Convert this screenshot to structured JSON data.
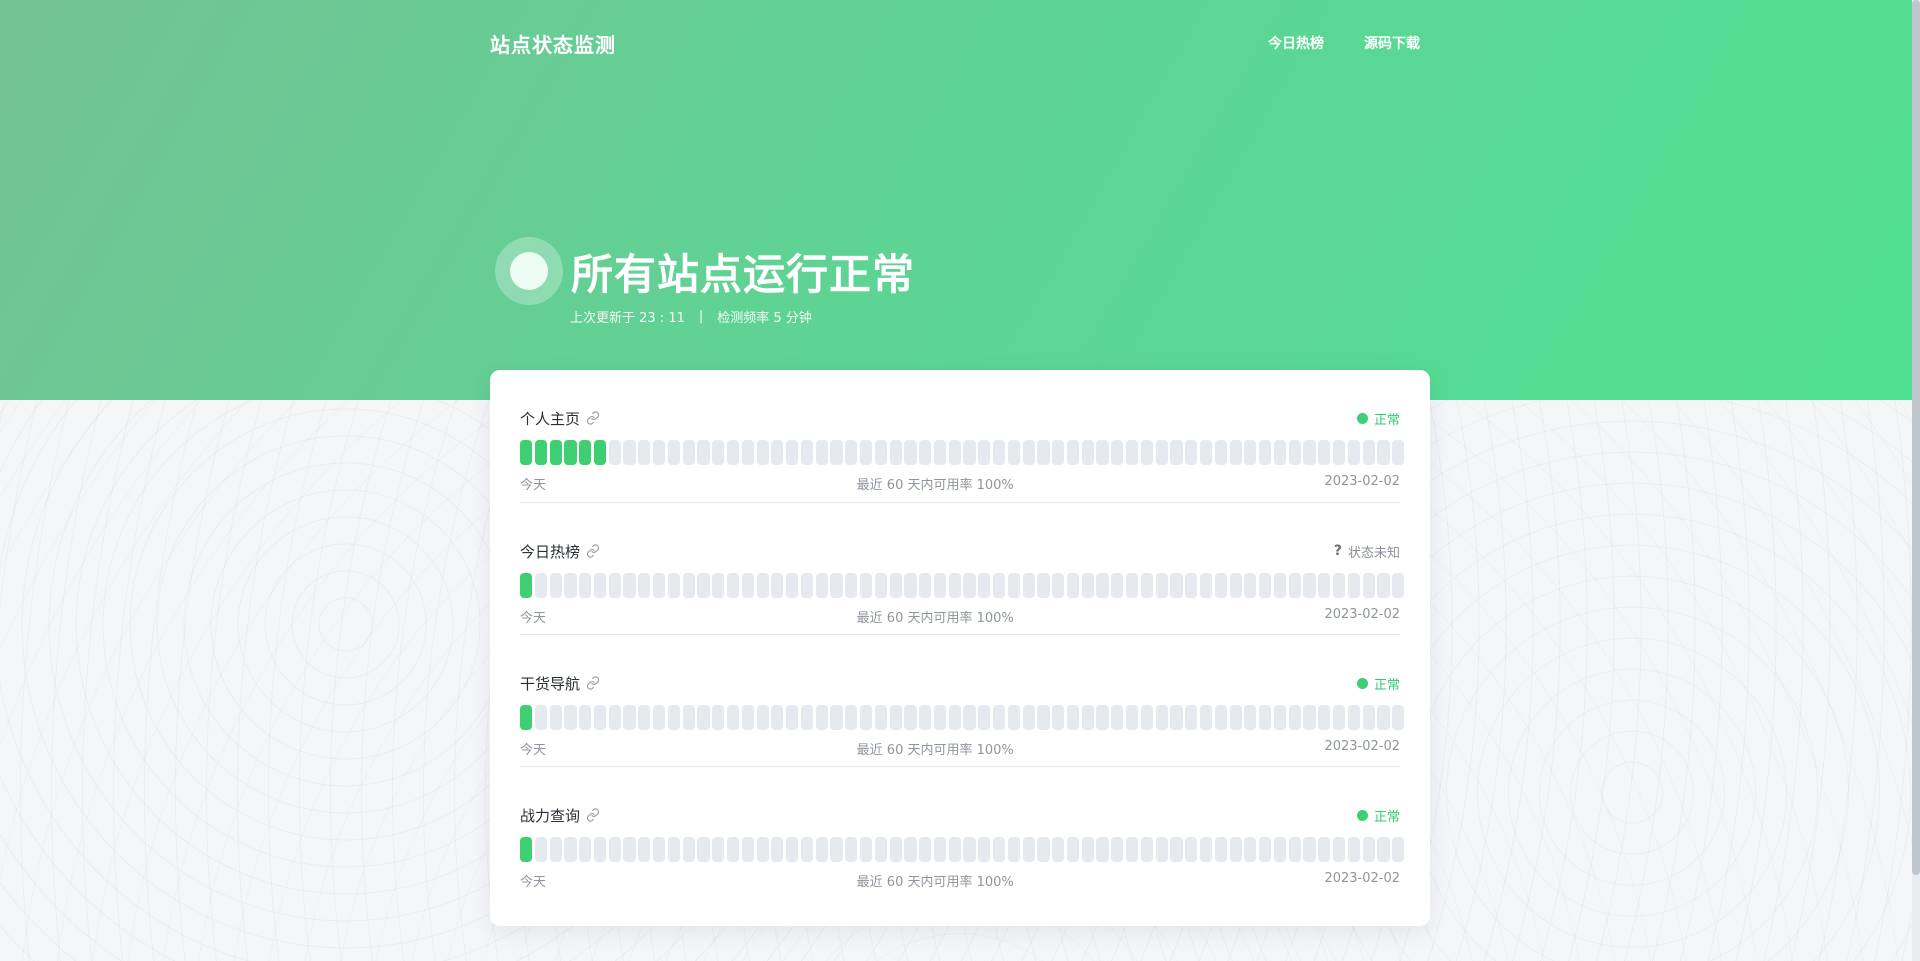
{
  "header": {
    "brand": "站点状态监测",
    "nav": [
      {
        "label": "今日热榜"
      },
      {
        "label": "源码下载"
      }
    ]
  },
  "hero": {
    "title": "所有站点运行正常",
    "updated": "上次更新于 23 : 11",
    "separator": "|",
    "frequency": "检测频率 5 分钟"
  },
  "colors": {
    "accent": "#3ecf73",
    "bar_empty": "#e6e9ed"
  },
  "monitors": [
    {
      "name": "个人主页",
      "status": "正常",
      "status_type": "ok",
      "bars_total": 60,
      "bars_up": 6,
      "footer_left": "今天",
      "footer_mid": "最近 60 天内可用率 100%",
      "footer_right": "2023-02-02"
    },
    {
      "name": "今日热榜",
      "status": "状态未知",
      "status_type": "unknown",
      "bars_total": 60,
      "bars_up": 1,
      "footer_left": "今天",
      "footer_mid": "最近 60 天内可用率 100%",
      "footer_right": "2023-02-02"
    },
    {
      "name": "干货导航",
      "status": "正常",
      "status_type": "ok",
      "bars_total": 60,
      "bars_up": 1,
      "footer_left": "今天",
      "footer_mid": "最近 60 天内可用率 100%",
      "footer_right": "2023-02-02"
    },
    {
      "name": "战力查询",
      "status": "正常",
      "status_type": "ok",
      "bars_total": 60,
      "bars_up": 1,
      "footer_left": "今天",
      "footer_mid": "最近 60 天内可用率 100%",
      "footer_right": "2023-02-02"
    }
  ]
}
